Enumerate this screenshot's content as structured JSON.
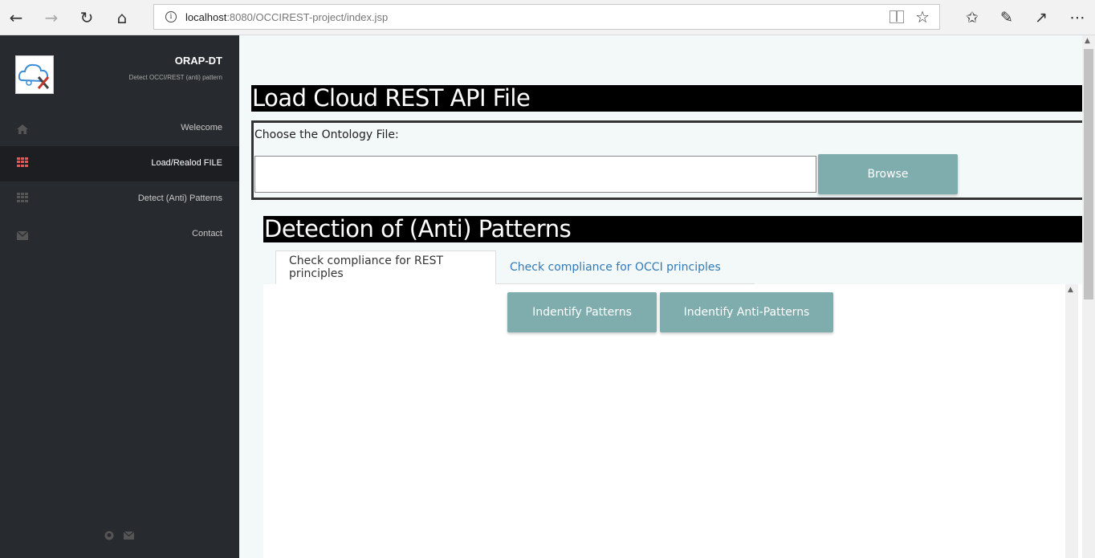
{
  "browser": {
    "url_host": "localhost",
    "url_rest": ":8080/OCCIREST-project/index.jsp"
  },
  "sidebar": {
    "brand_name": "ORAP-DT",
    "brand_tagline": "Detect OCCI/REST (anti) pattern",
    "items": [
      {
        "label": "Welecome",
        "icon": "home-icon"
      },
      {
        "label": "Load/Realod FILE",
        "icon": "grid-icon",
        "active": true
      },
      {
        "label": "Detect (Anti) Patterns",
        "icon": "grid-icon"
      },
      {
        "label": "Contact",
        "icon": "envelope-icon"
      }
    ]
  },
  "main": {
    "load_heading": "Load Cloud REST API File",
    "choose_label": "Choose the Ontology File:",
    "file_value": "",
    "browse_label": "Browse",
    "detect_heading": "Detection of (Anti) Patterns",
    "tabs": [
      {
        "label": "Check compliance for REST principles",
        "active": true
      },
      {
        "label": "Check compliance for OCCI principles",
        "active": false
      }
    ],
    "identify_patterns_label": "Indentify Patterns",
    "identify_anti_patterns_label": "Indentify Anti-Patterns"
  },
  "colors": {
    "sidebar_bg": "#272a2f",
    "accent_button": "#7fadad",
    "active_icon": "#e05a5a",
    "link": "#337ab7"
  }
}
